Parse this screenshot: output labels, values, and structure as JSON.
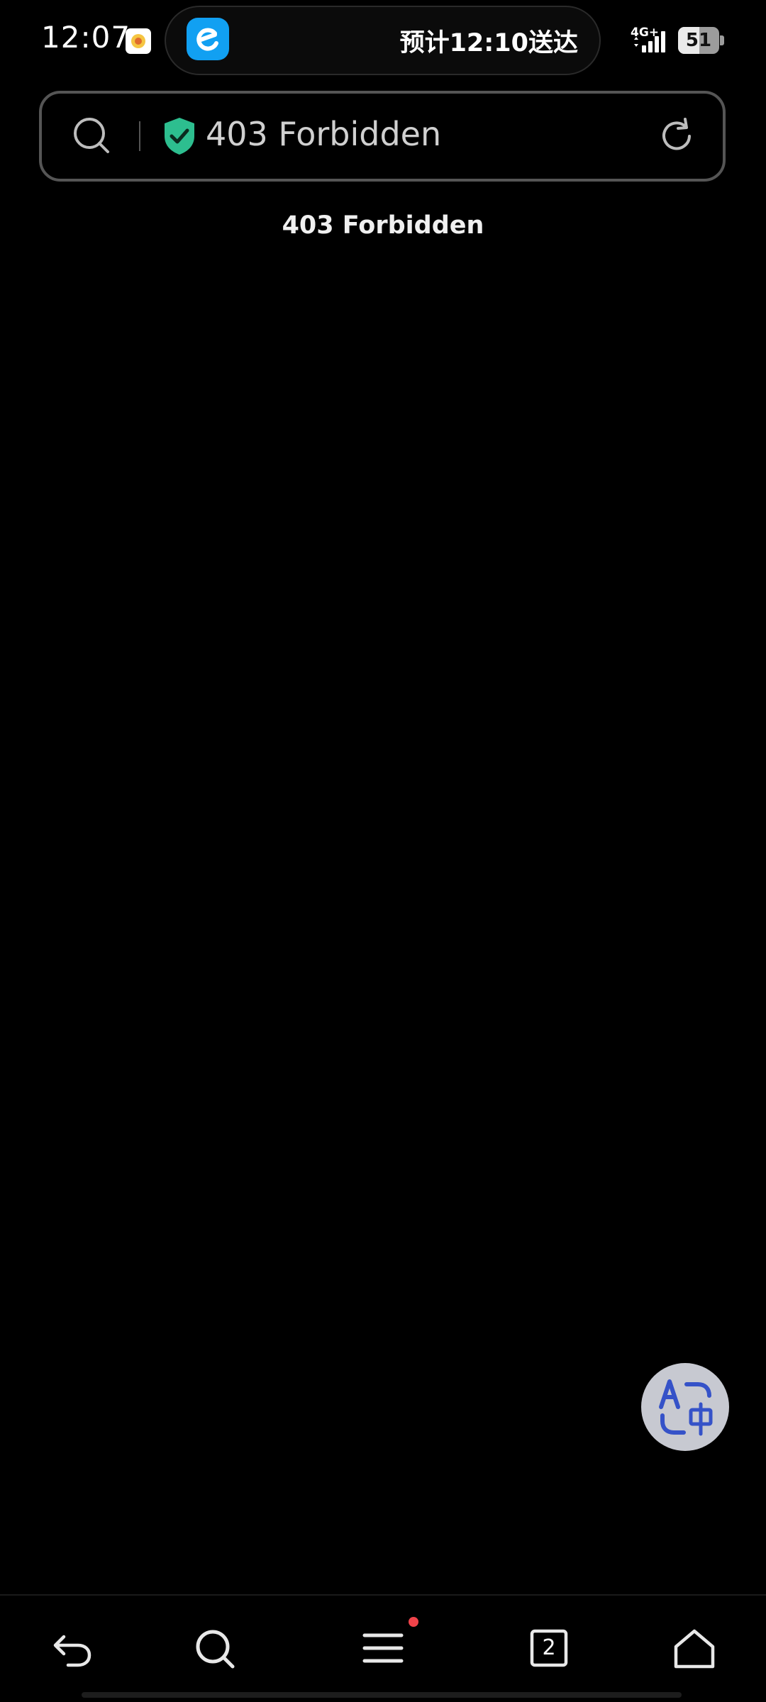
{
  "status_bar": {
    "time": "12:07",
    "live_activity_text": "预计12:10送达",
    "network_label": "4G+",
    "battery_level": "51",
    "battery_fraction": 0.51
  },
  "address_bar": {
    "page_title": "403 Forbidden",
    "security_color": "#2dbe8f"
  },
  "page": {
    "heading": "403 Forbidden"
  },
  "toolbar": {
    "tab_count": "2",
    "menu_badge_color": "#f0434a"
  },
  "icons": {
    "notification": "notification-app-icon",
    "live_app": "eleme-app-icon",
    "search": "search-icon",
    "security": "shield-check-icon",
    "reload": "refresh-icon",
    "translate": "translate-icon",
    "back": "back-arrow-icon",
    "menu": "hamburger-menu-icon",
    "home": "home-icon"
  }
}
